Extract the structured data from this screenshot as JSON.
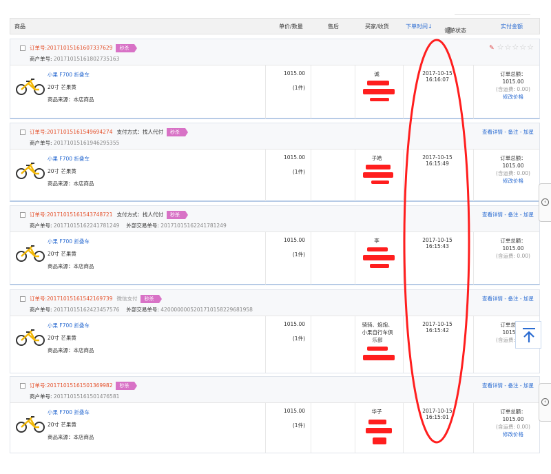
{
  "header": {
    "col_product": "商品",
    "col_price_qty": "单价/数量",
    "col_aftersale": "售后",
    "col_buyer": "买家/收货",
    "col_order_time": "下单时间↓",
    "col_status": "订单状态",
    "col_paid": "实付金额",
    "help_icon": "?"
  },
  "labels": {
    "order_no_prefix": "订单号:",
    "merchant_prefix": "商户单号:",
    "external_prefix": "外部交易单号:",
    "pay_method_proxy": "支付方式：找人代付",
    "pay_wechat": "微信支付",
    "flash_sale": "秒杀",
    "total_label": "订单总额：",
    "shipping_note": "(含运费: 0.00)",
    "modify_price": "修改价格",
    "product_name": "小果 F700 折叠车",
    "product_spec": "20寸 芒果黄",
    "product_source": "商品来源：本店商品",
    "actions": "查看详情 - 备注 - 加星",
    "side_tab_glyph": "‹",
    "pen_icon": "✎",
    "star_glyph": "☆"
  },
  "orders": [
    {
      "order_no": "20171015161607337629",
      "merchant_no": "201710151618027351​63",
      "price": "1015.00",
      "qty": "(1件)",
      "buyer": "诚",
      "time_date": "2017-10-15",
      "time_clock": "16:16:07",
      "total": "1015.00",
      "shipping_zero": "(含运费: 0.00)",
      "modify": "修改价格"
    },
    {
      "order_no": "20171015161549694274",
      "merchant_no": "20171015161946295355",
      "price": "1015.00",
      "qty": "(1件)",
      "buyer": "子皓",
      "time_date": "2017-10-15",
      "time_clock": "16:15:49",
      "total": "1015.00",
      "shipping_zero": "(含运费: 0.00)",
      "modify": "修改价格"
    },
    {
      "order_no": "20171015161543748721",
      "merchant_no": "20171015162241781249",
      "external_no": "20171015162241781249",
      "price": "1015.00",
      "qty": "(1件)",
      "buyer": "李",
      "time_date": "2017-10-15",
      "time_clock": "16:15:43",
      "total": "1015.00",
      "shipping_zero": "(含运费: 0.00)"
    },
    {
      "order_no": "20171015161542169739",
      "merchant_no": "20171015162423457576",
      "external_no": "4200000005201710158229681958",
      "price": "1015.00",
      "qty": "(1件)",
      "buyer": "骑骑、炮炮、小果自行车俱乐部",
      "time_date": "2017-10-15",
      "time_clock": "16:15:42",
      "total": "1015.00",
      "shipping_zero": "(含运费: 0.00)"
    },
    {
      "order_no": "20171015161501369982",
      "merchant_no": "20171015161501476581",
      "price": "1015.00",
      "qty": "(1件)",
      "buyer": "华子",
      "time_date": "2017-10-15",
      "time_clock": "16:15:01",
      "total": "1015.00",
      "shipping_zero": "(含运费: 0.00)",
      "modify": "修改价格"
    }
  ],
  "colors": {
    "accent_blue": "#2a6bd1",
    "order_red": "#e4502a",
    "badge_pink": "#d872c6",
    "annotation_red": "#ff1e1e"
  }
}
